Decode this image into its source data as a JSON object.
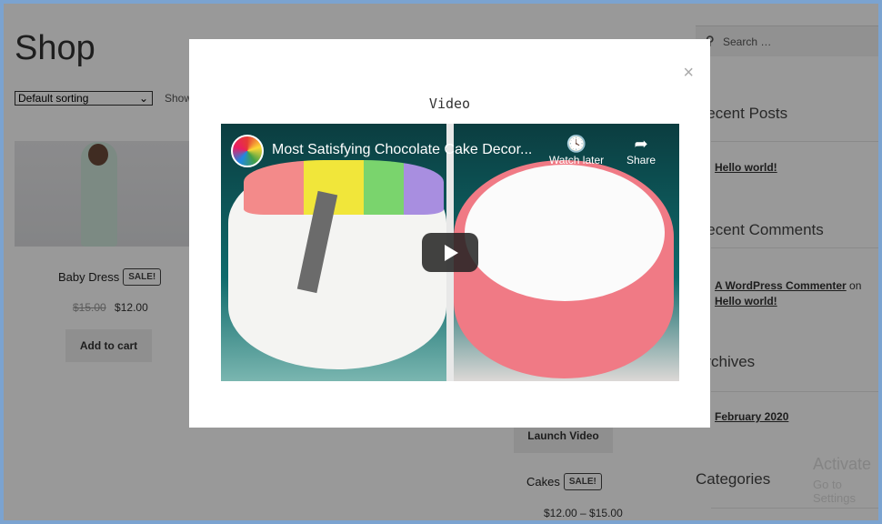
{
  "shop": {
    "title": "Shop",
    "sorting": "Default sorting",
    "showing": "Showing",
    "products": [
      {
        "name": "Baby Dress",
        "badge": "SALE!",
        "old_price": "$15.00",
        "price": "$12.00",
        "button": "Add to cart"
      },
      {
        "name": "Cakes",
        "badge": "SALE!",
        "price_range": "$12.00 – $15.00",
        "button": "Launch Video"
      }
    ]
  },
  "sidebar": {
    "search_placeholder": "Search …",
    "recent_posts": "Recent Posts",
    "post": "Hello world!",
    "recent_comments": "Recent Comments",
    "commenter": "A WordPress Commenter",
    "on": "on",
    "comment_post": "Hello world!",
    "archives": "Archives",
    "archive": "February 2020",
    "categories": "Categories"
  },
  "watermark": {
    "line1": "Activate",
    "line2": "Go to Settings"
  },
  "modal": {
    "title": "Video",
    "close": "×",
    "video": {
      "title": "Most Satisfying Chocolate Cake Decor...",
      "watch_later": "Watch later",
      "share": "Share"
    }
  },
  "colors": {
    "frame": "#7ba3d0",
    "overlay": "rgba(0,0,0,0.4)"
  }
}
